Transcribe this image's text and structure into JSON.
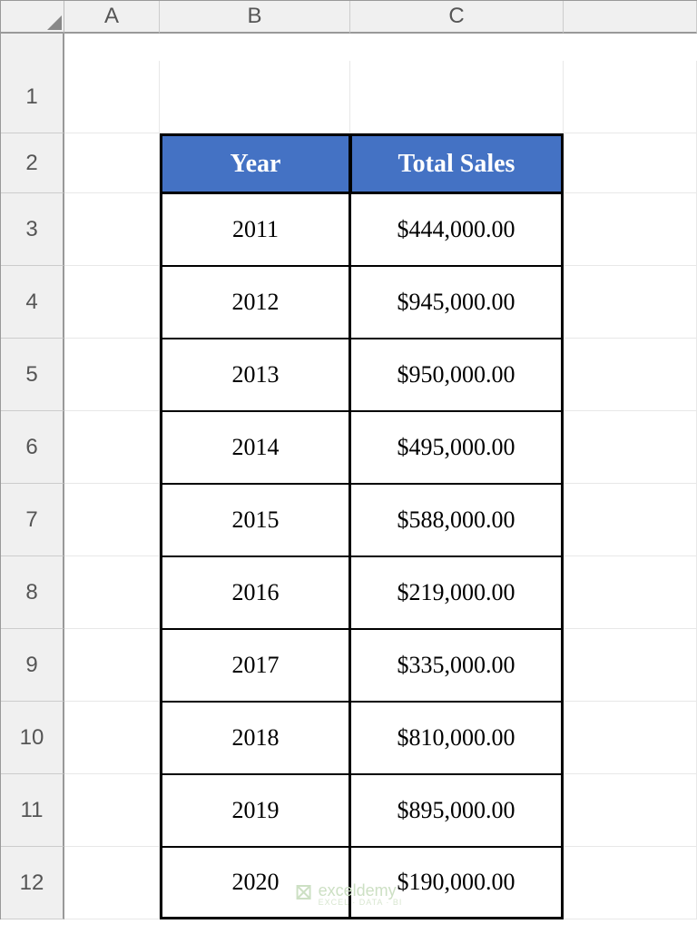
{
  "columns": [
    "A",
    "B",
    "C"
  ],
  "rows": [
    "1",
    "2",
    "3",
    "4",
    "5",
    "6",
    "7",
    "8",
    "9",
    "10",
    "11",
    "12"
  ],
  "table": {
    "headers": {
      "year": "Year",
      "sales": "Total Sales"
    },
    "data": [
      {
        "year": "2011",
        "sales": "$444,000.00"
      },
      {
        "year": "2012",
        "sales": "$945,000.00"
      },
      {
        "year": "2013",
        "sales": "$950,000.00"
      },
      {
        "year": "2014",
        "sales": "$495,000.00"
      },
      {
        "year": "2015",
        "sales": "$588,000.00"
      },
      {
        "year": "2016",
        "sales": "$219,000.00"
      },
      {
        "year": "2017",
        "sales": "$335,000.00"
      },
      {
        "year": "2018",
        "sales": "$810,000.00"
      },
      {
        "year": "2019",
        "sales": "$895,000.00"
      },
      {
        "year": "2020",
        "sales": "$190,000.00"
      }
    ]
  },
  "watermark": {
    "name": "exceldemy",
    "tagline": "EXCEL · DATA · BI"
  }
}
